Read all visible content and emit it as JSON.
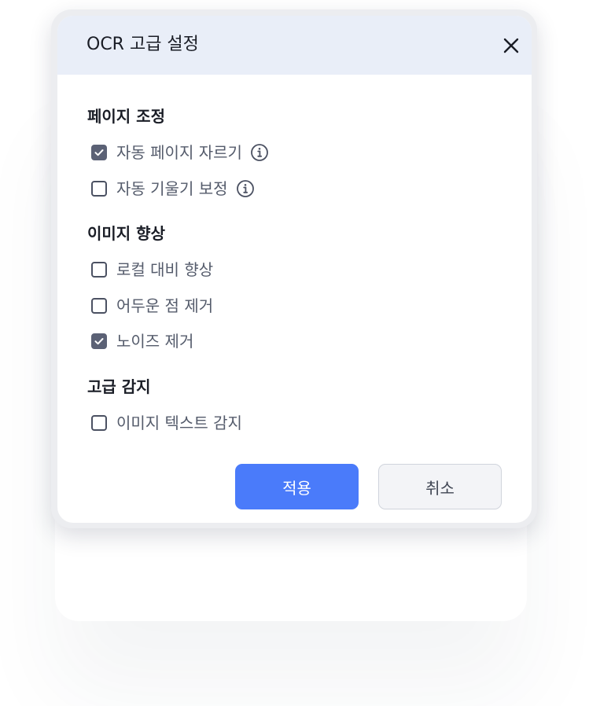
{
  "dialog": {
    "title": "OCR 고급 설정",
    "close_icon": "close-icon"
  },
  "sections": [
    {
      "title": "페이지 조정",
      "options": [
        {
          "label": "자동 페이지 자르기",
          "checked": true,
          "info_icon": "info-icon"
        },
        {
          "label": "자동 기울기 보정",
          "checked": false,
          "info_icon": "info-icon"
        }
      ]
    },
    {
      "title": "이미지 향상",
      "options": [
        {
          "label": "로컬 대비 향상",
          "checked": false
        },
        {
          "label": "어두운 점 제거",
          "checked": false
        },
        {
          "label": "노이즈 제거",
          "checked": true
        }
      ]
    },
    {
      "title": "고급 감지",
      "options": [
        {
          "label": "이미지 텍스트 감지",
          "checked": false
        }
      ]
    }
  ],
  "buttons": {
    "apply_label": "적용",
    "cancel_label": "취소"
  },
  "colors": {
    "header_bg": "#e9eef8",
    "primary": "#4a7bfa",
    "checkbox_checked": "#5b6175"
  }
}
